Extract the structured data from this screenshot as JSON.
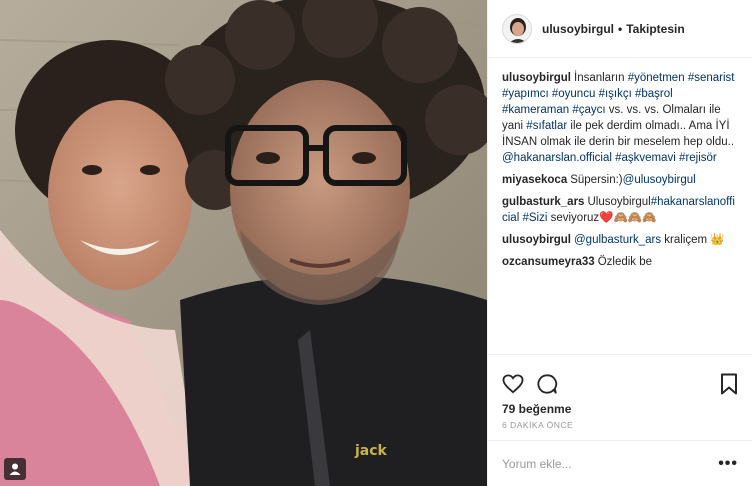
{
  "post": {
    "username": "ulusoybirgul",
    "separator": "•",
    "follow_status": "Takiptesin",
    "photo_badge_icon": "user-tag-icon"
  },
  "comments": [
    {
      "user": "ulusoybirgul",
      "parts": [
        {
          "t": "İnsanların "
        },
        {
          "t": "#yönetmen",
          "tag": true
        },
        {
          "t": " "
        },
        {
          "t": "#senarist",
          "tag": true
        },
        {
          "t": " "
        },
        {
          "t": "#yapımcı",
          "tag": true
        },
        {
          "t": " "
        },
        {
          "t": "#oyuncu",
          "tag": true
        },
        {
          "t": " "
        },
        {
          "t": "#ışıkçı",
          "tag": true
        },
        {
          "t": " "
        },
        {
          "t": "#başrol",
          "tag": true
        },
        {
          "t": " "
        },
        {
          "t": "#kameraman",
          "tag": true
        },
        {
          "t": " "
        },
        {
          "t": "#çaycı",
          "tag": true
        },
        {
          "t": " vs. vs. vs. Olmaları ile yani "
        },
        {
          "t": "#sıfatlar",
          "tag": true
        },
        {
          "t": " ile pek derdim olmadı.. Ama İYİ İNSAN olmak ile derin bir meselem hep oldu.. "
        },
        {
          "t": "@hakanarslan.official",
          "tag": true
        },
        {
          "t": " "
        },
        {
          "t": "#aşkvemavi",
          "tag": true
        },
        {
          "t": " "
        },
        {
          "t": "#rejisör",
          "tag": true
        }
      ]
    },
    {
      "user": "miyasekoca",
      "parts": [
        {
          "t": "Süpersin:)"
        },
        {
          "t": "@ulusoybirgul",
          "tag": true
        }
      ]
    },
    {
      "user": "gulbasturk_ars",
      "parts": [
        {
          "t": "Ulusoybirgul"
        },
        {
          "t": "#hakanarslanofficial",
          "tag": true
        },
        {
          "t": " "
        },
        {
          "t": "#Sizi",
          "tag": true
        },
        {
          "t": " seviyoruz❤️🙈🙈🙈"
        }
      ]
    },
    {
      "user": "ulusoybirgul",
      "parts": [
        {
          "t": "@gulbasturk_ars",
          "tag": true
        },
        {
          "t": " kraliçem 👑"
        }
      ]
    },
    {
      "user": "ozcansumeyra33",
      "parts": [
        {
          "t": "Özledik be"
        }
      ]
    }
  ],
  "actions": {
    "like_icon": "heart-icon",
    "comment_icon": "comment-bubble-icon",
    "save_icon": "bookmark-icon"
  },
  "likes_text": "79 beğenme",
  "time_text": "6 DAKİKA ÖNCE",
  "add_comment": {
    "placeholder": "Yorum ekle...",
    "more_label": "•••"
  },
  "colors": {
    "text": "#262626",
    "link": "#003569",
    "muted": "#999999",
    "border": "#efefef"
  }
}
